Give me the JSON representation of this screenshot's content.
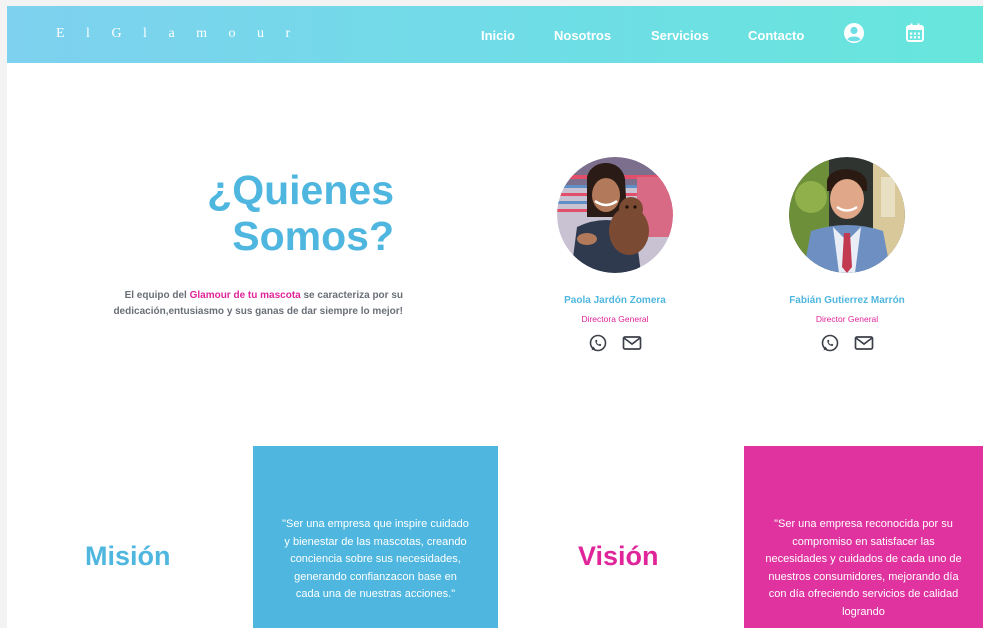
{
  "navbar": {
    "brand": "E l G l a m o u r",
    "links": [
      "Inicio",
      "Nosotros",
      "Servicios",
      "Contacto"
    ],
    "icons": [
      "user-circle-icon",
      "calendar-icon"
    ]
  },
  "hero": {
    "title_line1": "¿Quienes",
    "title_line2": "Somos?",
    "desc_pre": "El equipo del ",
    "desc_highlight": "Glamour de tu mascota",
    "desc_post": " se caracteriza por su dedicación,entusiasmo y sus ganas de dar siempre lo mejor!"
  },
  "team": [
    {
      "name": "Paola Jardón Zomera",
      "role": "Directora General",
      "icons": [
        "whatsapp-icon",
        "mail-icon"
      ]
    },
    {
      "name": "Fabián Gutierrez Marrón",
      "role": "Director General",
      "icons": [
        "whatsapp-icon",
        "mail-icon"
      ]
    }
  ],
  "mission": {
    "heading": "Misión",
    "text": "\"Ser una empresa que inspire cuidado y bienestar de las mascotas, creando conciencia sobre sus necesidades, generando confianzacon base en cada una de nuestras acciones.\""
  },
  "vision": {
    "heading": "Visión",
    "text": "\"Ser una empresa reconocida por su compromiso en satisfacer las necesidades y cuidados de cada uno de nuestros consumidores, mejorando día con día ofreciendo servicios de calidad logrando"
  },
  "colors": {
    "nav_start": "#7ed1ef",
    "nav_end": "#67e6dc",
    "primary_blue": "#4fb7df",
    "accent_pink": "#e0259a",
    "mission_box": "#4fb7df",
    "vision_box": "#e0339f"
  }
}
